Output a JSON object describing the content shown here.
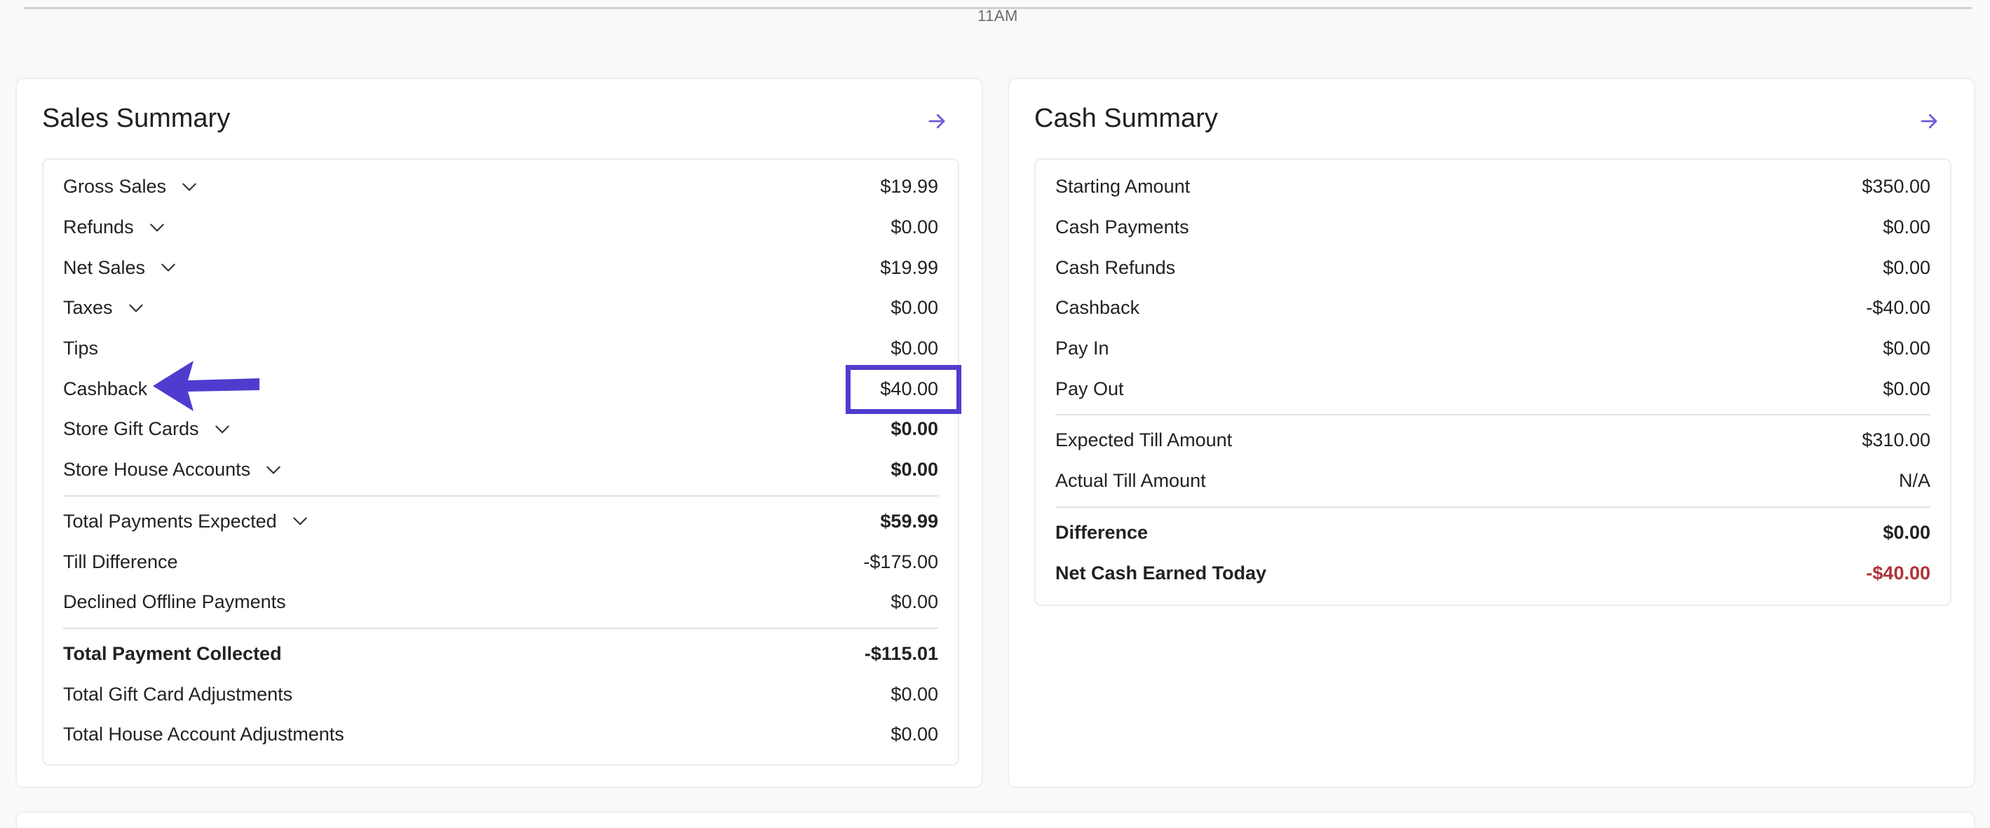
{
  "timeline": {
    "time_label": "11AM"
  },
  "sales_summary": {
    "title": "Sales Summary",
    "rows_a": [
      {
        "label": "Gross Sales",
        "value": "$19.99",
        "expandable": true
      },
      {
        "label": "Refunds",
        "value": "$0.00",
        "expandable": true
      },
      {
        "label": "Net Sales",
        "value": "$19.99",
        "expandable": true
      },
      {
        "label": "Taxes",
        "value": "$0.00",
        "expandable": true
      },
      {
        "label": "Tips",
        "value": "$0.00",
        "expandable": false
      },
      {
        "label": "Cashback",
        "value": "$40.00",
        "expandable": false
      },
      {
        "label": "Store Gift Cards",
        "value": "$0.00",
        "expandable": true
      },
      {
        "label": "Store House Accounts",
        "value": "$0.00",
        "expandable": true
      }
    ],
    "rows_b": [
      {
        "label": "Total Payments Expected",
        "value": "$59.99",
        "expandable": true
      },
      {
        "label": "Till Difference",
        "value": "-$175.00",
        "expandable": false
      },
      {
        "label": "Declined Offline Payments",
        "value": "$0.00",
        "expandable": false
      }
    ],
    "rows_c": [
      {
        "label": "Total Payment Collected",
        "value": "-$115.01"
      },
      {
        "label": "Total Gift Card Adjustments",
        "value": "$0.00"
      },
      {
        "label": "Total House Account Adjustments",
        "value": "$0.00"
      }
    ]
  },
  "cash_summary": {
    "title": "Cash Summary",
    "rows_a": [
      {
        "label": "Starting Amount",
        "value": "$350.00"
      },
      {
        "label": "Cash Payments",
        "value": "$0.00"
      },
      {
        "label": "Cash Refunds",
        "value": "$0.00"
      },
      {
        "label": "Cashback",
        "value": "-$40.00"
      },
      {
        "label": "Pay In",
        "value": "$0.00"
      },
      {
        "label": "Pay Out",
        "value": "$0.00"
      }
    ],
    "rows_b": [
      {
        "label": "Expected Till Amount",
        "value": "$310.00"
      },
      {
        "label": "Actual Till Amount",
        "value": "N/A"
      }
    ],
    "rows_c": [
      {
        "label": "Difference",
        "value": "$0.00"
      },
      {
        "label": "Net Cash Earned Today",
        "value": "-$40.00"
      }
    ]
  },
  "colors": {
    "accent": "#6b5bd6",
    "annotation": "#4f3ccf",
    "negative": "#b0323a"
  },
  "icons": {
    "navigate": "arrow-right-icon",
    "expand": "chevron-down-icon"
  }
}
